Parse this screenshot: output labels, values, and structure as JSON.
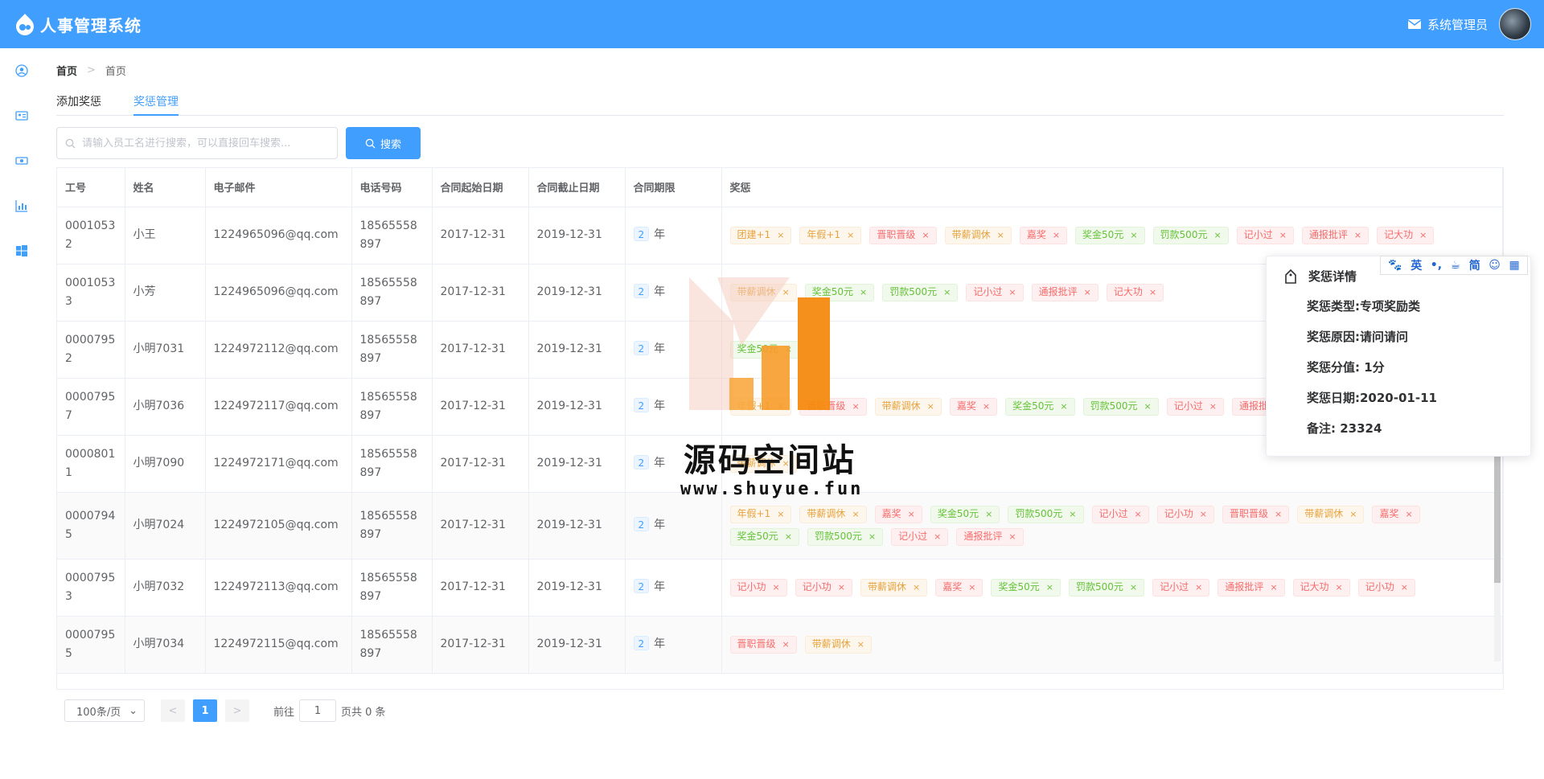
{
  "header": {
    "title": "人事管理系统",
    "user_name": "系统管理员"
  },
  "sidebar": {
    "items": [
      {
        "icon": "user-icon"
      },
      {
        "icon": "id-card-icon"
      },
      {
        "icon": "money-icon"
      },
      {
        "icon": "chart-icon"
      },
      {
        "icon": "windows-icon"
      }
    ]
  },
  "breadcrumb": {
    "home": "首页",
    "current": "首页"
  },
  "tabs": [
    {
      "label": "添加奖惩"
    },
    {
      "label": "奖惩管理"
    }
  ],
  "search": {
    "placeholder": "请输入员工名进行搜索，可以直接回车搜索...",
    "button_label": "搜索"
  },
  "table": {
    "headers": [
      "工号",
      "姓名",
      "电子邮件",
      "电话号码",
      "合同起始日期",
      "合同截止日期",
      "合同期限",
      "奖惩"
    ],
    "rows": [
      {
        "id": "00010532",
        "name": "小王",
        "email": "1224965096@qq.com",
        "phone": "18565558897",
        "start": "2017-12-31",
        "end": "2019-12-31",
        "term": "2",
        "term_unit": "年",
        "tags": [
          [
            "团建+1",
            "warning"
          ],
          [
            "年假+1",
            "warning"
          ],
          [
            "晋职晋级",
            "danger"
          ],
          [
            "带薪调休",
            "warning"
          ],
          [
            "嘉奖",
            "danger"
          ],
          [
            "奖金50元",
            "success"
          ],
          [
            "罚款500元",
            "success"
          ],
          [
            "记小过",
            "danger"
          ],
          [
            "通报批评",
            "danger"
          ],
          [
            "记大功",
            "danger"
          ]
        ]
      },
      {
        "id": "00010533",
        "name": "小芳",
        "email": "1224965096@qq.com",
        "phone": "18565558897",
        "start": "2017-12-31",
        "end": "2019-12-31",
        "term": "2",
        "term_unit": "年",
        "tags": [
          [
            "带薪调休",
            "warning"
          ],
          [
            "奖金50元",
            "success"
          ],
          [
            "罚款500元",
            "success"
          ],
          [
            "记小过",
            "danger"
          ],
          [
            "通报批评",
            "danger"
          ],
          [
            "记大功",
            "danger"
          ]
        ]
      },
      {
        "id": "00007952",
        "name": "小明7031",
        "email": "1224972112@qq.com",
        "phone": "18565558897",
        "start": "2017-12-31",
        "end": "2019-12-31",
        "term": "2",
        "term_unit": "年",
        "tags": [
          [
            "奖金50元",
            "success"
          ]
        ]
      },
      {
        "id": "00007957",
        "name": "小明7036",
        "email": "1224972117@qq.com",
        "phone": "18565558897",
        "start": "2017-12-31",
        "end": "2019-12-31",
        "term": "2",
        "term_unit": "年",
        "tags": [
          [
            "年假+1",
            "warning"
          ],
          [
            "晋职晋级",
            "danger"
          ],
          [
            "带薪调休",
            "warning"
          ],
          [
            "嘉奖",
            "danger"
          ],
          [
            "奖金50元",
            "success"
          ],
          [
            "罚款500元",
            "success"
          ],
          [
            "记小过",
            "danger"
          ],
          [
            "通报批评",
            "danger"
          ]
        ]
      },
      {
        "id": "00008011",
        "name": "小明7090",
        "email": "1224972171@qq.com",
        "phone": "18565558897",
        "start": "2017-12-31",
        "end": "2019-12-31",
        "term": "2",
        "term_unit": "年",
        "tags": [
          [
            "带薪调休",
            "warning"
          ]
        ]
      },
      {
        "id": "00007945",
        "name": "小明7024",
        "email": "1224972105@qq.com",
        "phone": "18565558897",
        "start": "2017-12-31",
        "end": "2019-12-31",
        "term": "2",
        "term_unit": "年",
        "tags": [
          [
            "年假+1",
            "warning"
          ],
          [
            "带薪调休",
            "warning"
          ],
          [
            "嘉奖",
            "danger"
          ],
          [
            "奖金50元",
            "success"
          ],
          [
            "罚款500元",
            "success"
          ],
          [
            "记小过",
            "danger"
          ],
          [
            "记小功",
            "danger"
          ],
          [
            "晋职晋级",
            "danger"
          ],
          [
            "带薪调休",
            "warning"
          ],
          [
            "嘉奖",
            "danger"
          ],
          [
            "奖金50元",
            "success"
          ],
          [
            "罚款500元",
            "success"
          ],
          [
            "记小过",
            "danger"
          ],
          [
            "通报批评",
            "danger"
          ]
        ]
      },
      {
        "id": "00007953",
        "name": "小明7032",
        "email": "1224972113@qq.com",
        "phone": "18565558897",
        "start": "2017-12-31",
        "end": "2019-12-31",
        "term": "2",
        "term_unit": "年",
        "tags": [
          [
            "记小功",
            "danger"
          ],
          [
            "记小功",
            "danger"
          ],
          [
            "带薪调休",
            "warning"
          ],
          [
            "嘉奖",
            "danger"
          ],
          [
            "奖金50元",
            "success"
          ],
          [
            "罚款500元",
            "success"
          ],
          [
            "记小过",
            "danger"
          ],
          [
            "通报批评",
            "danger"
          ],
          [
            "记大功",
            "danger"
          ],
          [
            "记小功",
            "danger"
          ]
        ]
      },
      {
        "id": "00007955",
        "name": "小明7034",
        "email": "1224972115@qq.com",
        "phone": "18565558897",
        "start": "2017-12-31",
        "end": "2019-12-31",
        "term": "2",
        "term_unit": "年",
        "tags": [
          [
            "晋职晋级",
            "danger"
          ],
          [
            "带薪调休",
            "warning"
          ]
        ]
      }
    ]
  },
  "pagination": {
    "page_size": "100条/页",
    "current_page": "1",
    "goto_label": "前往",
    "goto_value": "1",
    "total": "页共 0 条"
  },
  "popover": {
    "title": "奖惩详情",
    "type": "奖惩类型:专项奖励类",
    "reason": "奖惩原因:请问请问",
    "score": "奖惩分值: 1分",
    "date": "奖惩日期:2020-01-11",
    "remark": "备注: 23324"
  },
  "ime_toolbar": {
    "items": [
      "英",
      "简"
    ]
  },
  "watermark": {
    "text": "源码空间站",
    "url": "www.shuyue.fun"
  },
  "colors": {
    "primary": "#409eff",
    "warning": "#e6a23c",
    "danger": "#f56c6c",
    "success": "#67c23a"
  }
}
